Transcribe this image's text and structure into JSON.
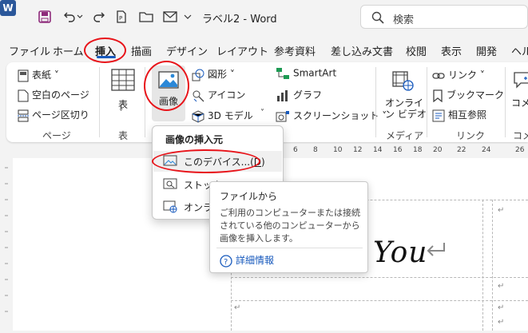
{
  "titlebar": {
    "app_icon": "W",
    "title": "ラベル2  -  Word",
    "search_placeholder": "検索",
    "icons": [
      "word-app-icon",
      "save-icon",
      "undo-icon",
      "undo-dropdown-icon",
      "redo-icon",
      "new-doc-icon",
      "open-folder-icon",
      "email-icon",
      "customize-qat-icon"
    ]
  },
  "tabs": [
    "ファイル",
    "ホーム",
    "挿入",
    "描画",
    "デザイン",
    "レイアウト",
    "参考資料",
    "差し込み文書",
    "校閲",
    "表示",
    "開発",
    "ヘル"
  ],
  "active_tab": "挿入",
  "ribbon": {
    "pages_group": {
      "cover": "表紙 ˅",
      "blank": "空白のページ",
      "break": "ページ区切り",
      "label": "ページ"
    },
    "table_group": {
      "button": "表",
      "arrow": "˅",
      "label": "表"
    },
    "illustrations": {
      "picture": "画像",
      "shapes": "図形 ˅",
      "icons": "アイコン",
      "models3d": "3D モデル",
      "models3d_arrow": "˅",
      "smartart": "SmartArt",
      "chart": "グラフ",
      "screenshot": "スクリーンショット ˅"
    },
    "media": {
      "online_video_1": "オンライ",
      "online_video_2": "ン ビデオ",
      "label": "メディア"
    },
    "links": {
      "link": "リンク ˅",
      "bookmark": "ブックマーク",
      "crossref": "相互参照",
      "label": "リンク"
    },
    "comments": {
      "button": "コメ",
      "label": "コメ"
    }
  },
  "ruler_numbers": [
    "6",
    "8",
    "10",
    "12",
    "14",
    "16",
    "18",
    "20",
    "22",
    "24",
    "26"
  ],
  "dropdown": {
    "header": "画像の挿入元",
    "items": [
      "このデバイス...(",
      "D",
      ")",
      "ストック",
      "オンライ"
    ]
  },
  "tooltip": {
    "title": "ファイルから",
    "description": "ご利用のコンピューターまたは接続されている他のコンピューターから画像を挿入します。",
    "link": "詳細情報"
  },
  "document": {
    "text": "You",
    "return_mark": "↵"
  },
  "colors": {
    "accent": "#185abd",
    "highlight_ring": "#e8141a",
    "word_blue": "#2b579a"
  }
}
